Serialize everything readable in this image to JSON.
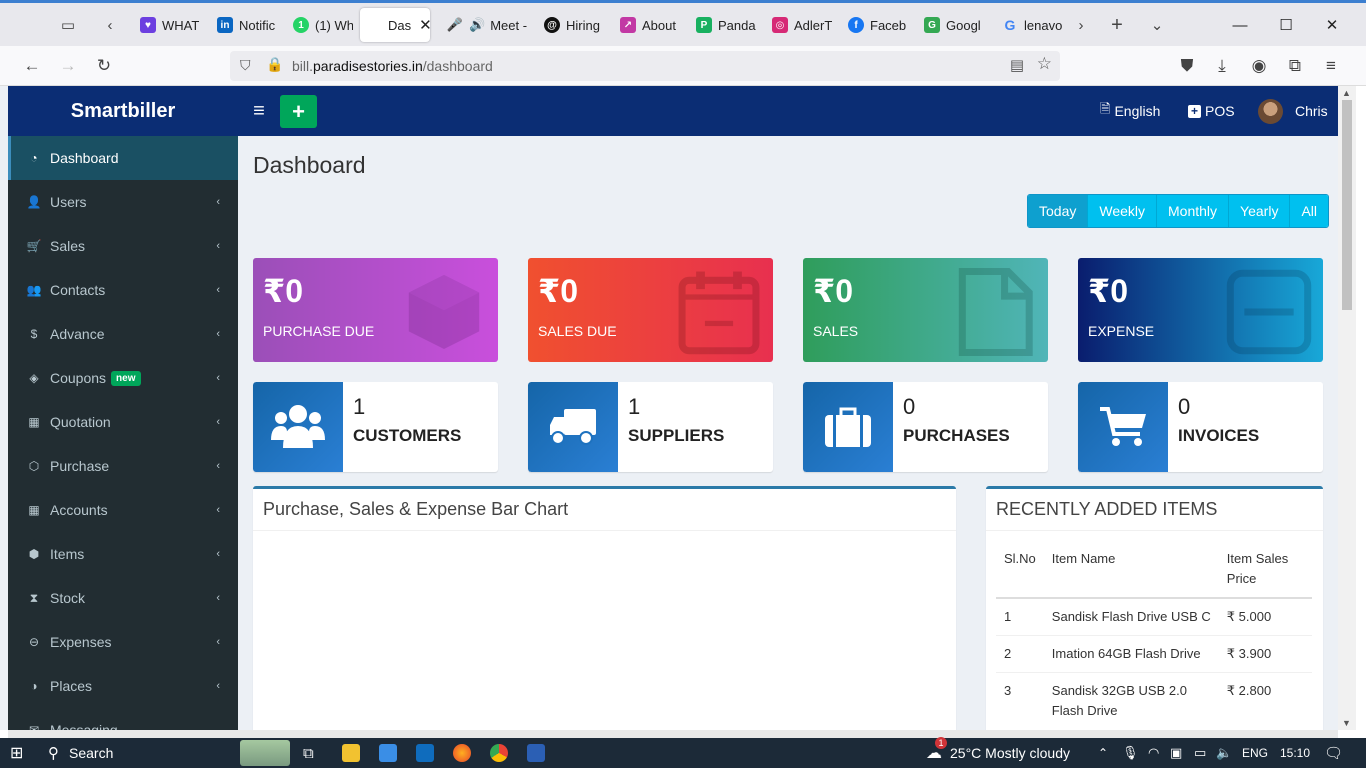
{
  "browser": {
    "tabs": [
      {
        "label": "WHAT",
        "color": "#6c3fe0"
      },
      {
        "label": "Notific",
        "color": "#0a66c2"
      },
      {
        "label": "(1) Wh",
        "color": "#25d366"
      },
      {
        "label": "Das",
        "color": "#cccccc",
        "active": true
      },
      {
        "label": "Meet -",
        "color": "#e53935"
      },
      {
        "label": "Hiring",
        "color": "#111111"
      },
      {
        "label": "About",
        "color": "#c238a4"
      },
      {
        "label": "Panda",
        "color": "#18b060"
      },
      {
        "label": "AdlerT",
        "color": "#d62976"
      },
      {
        "label": "Faceb",
        "color": "#1877f2"
      },
      {
        "label": "Googl",
        "color": "#34a853"
      },
      {
        "label": "lenavo",
        "color": "#4285f4"
      }
    ],
    "url_host_prefix": "bill.",
    "url_host_main": "paradisestories.in",
    "url_path": "/dashboard"
  },
  "app": {
    "logo": "Smartbiller",
    "language": "English",
    "pos_label": "POS",
    "user_name": "Chris",
    "page_title": "Dashboard"
  },
  "sidebar": {
    "items": [
      {
        "label": "Dashboard",
        "icon": "dashboard-icon",
        "active": true
      },
      {
        "label": "Users",
        "icon": "users-icon"
      },
      {
        "label": "Sales",
        "icon": "cart-icon"
      },
      {
        "label": "Contacts",
        "icon": "contacts-icon"
      },
      {
        "label": "Advance",
        "icon": "dollar-icon"
      },
      {
        "label": "Coupons",
        "icon": "coupon-icon",
        "badge": "new"
      },
      {
        "label": "Quotation",
        "icon": "calendar-icon"
      },
      {
        "label": "Purchase",
        "icon": "cube-icon"
      },
      {
        "label": "Accounts",
        "icon": "grid-icon"
      },
      {
        "label": "Items",
        "icon": "cubes-icon"
      },
      {
        "label": "Stock",
        "icon": "hourglass-icon"
      },
      {
        "label": "Expenses",
        "icon": "minus-circle-icon"
      },
      {
        "label": "Places",
        "icon": "map-icon"
      },
      {
        "label": "Messaging",
        "icon": "message-icon"
      }
    ]
  },
  "period": {
    "buttons": [
      "Today",
      "Weekly",
      "Monthly",
      "Yearly",
      "All"
    ],
    "active": "Today"
  },
  "stats": [
    {
      "amount": "₹0",
      "label": "PURCHASE DUE"
    },
    {
      "amount": "₹0",
      "label": "SALES DUE"
    },
    {
      "amount": "₹0",
      "label": "SALES"
    },
    {
      "amount": "₹0",
      "label": "EXPENSE"
    }
  ],
  "info": [
    {
      "count": "1",
      "label": "CUSTOMERS"
    },
    {
      "count": "1",
      "label": "SUPPLIERS"
    },
    {
      "count": "0",
      "label": "PURCHASES"
    },
    {
      "count": "0",
      "label": "INVOICES"
    }
  ],
  "chart_box": {
    "title": "Purchase, Sales & Expense Bar Chart"
  },
  "recent": {
    "title": "RECENTLY ADDED ITEMS",
    "headers": [
      "Sl.No",
      "Item Name",
      "Item Sales Price"
    ],
    "rows": [
      [
        "1",
        "Sandisk Flash Drive USB C",
        "₹ 5.000"
      ],
      [
        "2",
        "Imation 64GB Flash Drive",
        "₹ 3.900"
      ],
      [
        "3",
        "Sandisk 32GB USB 2.0 Flash Drive",
        "₹ 2.800"
      ]
    ]
  },
  "taskbar": {
    "search": "Search",
    "weather": "25°C  Mostly cloudy",
    "weather_alert": "1",
    "lang": "ENG",
    "time": "15:10"
  }
}
